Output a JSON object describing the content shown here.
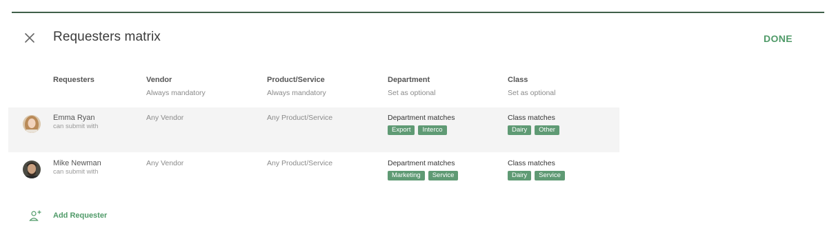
{
  "header": {
    "title": "Requesters matrix",
    "done_label": "DONE"
  },
  "columns": [
    {
      "label": "Requesters",
      "sub": ""
    },
    {
      "label": "Vendor",
      "sub": "Always mandatory"
    },
    {
      "label": "Product/Service",
      "sub": "Always mandatory"
    },
    {
      "label": "Department",
      "sub": "Set as optional"
    },
    {
      "label": "Class",
      "sub": "Set as optional"
    }
  ],
  "rows": [
    {
      "name": "Emma Ryan",
      "sub": "can submit with",
      "vendor": "Any Vendor",
      "product": "Any Product/Service",
      "department_label": "Department matches",
      "department_tags": [
        "Export",
        "Interco"
      ],
      "class_label": "Class matches",
      "class_tags": [
        "Dairy",
        "Other"
      ]
    },
    {
      "name": "Mike Newman",
      "sub": "can submit with",
      "vendor": "Any Vendor",
      "product": "Any Product/Service",
      "department_label": "Department matches",
      "department_tags": [
        "Marketing",
        "Service"
      ],
      "class_label": "Class matches",
      "class_tags": [
        "Dairy",
        "Service"
      ]
    }
  ],
  "add_requester_label": "Add Requester",
  "colors": {
    "accent": "#4f9a68",
    "tag_bg": "#5f9a74",
    "topline": "#3f5f48"
  }
}
